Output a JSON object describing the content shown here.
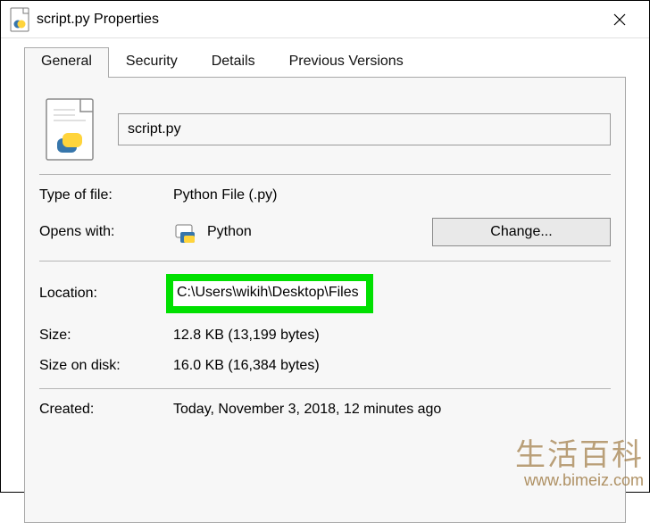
{
  "title": "script.py Properties",
  "tabs": [
    {
      "label": "General"
    },
    {
      "label": "Security"
    },
    {
      "label": "Details"
    },
    {
      "label": "Previous Versions"
    }
  ],
  "file": {
    "name": "script.py"
  },
  "fields": {
    "type_of_file_label": "Type of file:",
    "type_of_file_value": "Python File (.py)",
    "opens_with_label": "Opens with:",
    "opens_with_value": "Python",
    "change_button": "Change...",
    "location_label": "Location:",
    "location_value": "C:\\Users\\wikih\\Desktop\\Files",
    "size_label": "Size:",
    "size_value": "12.8 KB (13,199 bytes)",
    "size_on_disk_label": "Size on disk:",
    "size_on_disk_value": "16.0 KB (16,384 bytes)",
    "created_label": "Created:",
    "created_value": "Today, November 3, 2018, 12 minutes ago"
  },
  "watermark": {
    "cn": "生活百科",
    "url": "www.bimeiz.com"
  }
}
